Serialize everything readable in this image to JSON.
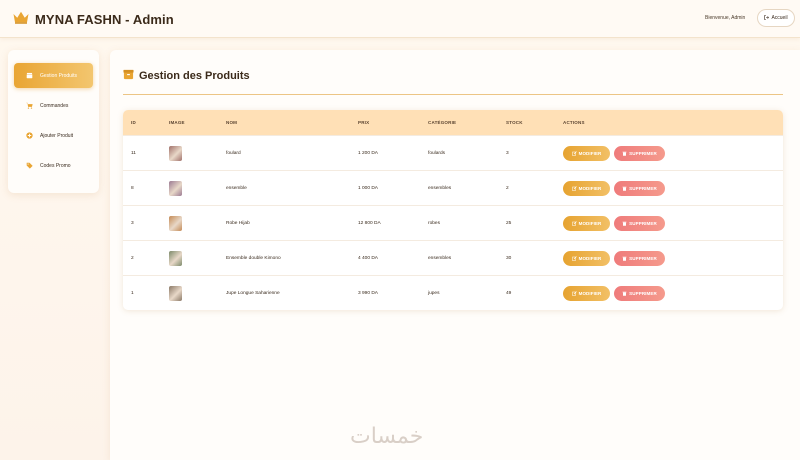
{
  "header": {
    "brand_title": "MYNA FASHN - Admin",
    "welcome_text": "Bienvenue, Admin",
    "home_button_label": "Accueil"
  },
  "sidebar": {
    "items": [
      {
        "label": "Gestion Produits",
        "icon": "box-icon",
        "active": true
      },
      {
        "label": "Commandes",
        "icon": "cart-icon",
        "active": false
      },
      {
        "label": "Ajouter Produit",
        "icon": "plus-circle-icon",
        "active": false
      },
      {
        "label": "Codes Promo",
        "icon": "tag-icon",
        "active": false
      }
    ]
  },
  "main": {
    "title": "Gestion des Produits",
    "columns": [
      "ID",
      "IMAGE",
      "NOM",
      "PRIX",
      "CATÉGORIE",
      "STOCK",
      "ACTIONS"
    ],
    "rows": [
      {
        "id": "11",
        "name": "foulard",
        "price": "1 200 DA",
        "category": "foulards",
        "stock": "3",
        "thumb_color": "#a0706a"
      },
      {
        "id": "8",
        "name": "ensemble",
        "price": "1 000 DA",
        "category": "ensembles",
        "stock": "2",
        "thumb_color": "#9b7a92"
      },
      {
        "id": "3",
        "name": "Robe Hijab",
        "price": "12 800 DA",
        "category": "robes",
        "stock": "25",
        "thumb_color": "#c48a55"
      },
      {
        "id": "2",
        "name": "Ensemble double Kimono",
        "price": "4 400 DA",
        "category": "ensembles",
        "stock": "30",
        "thumb_color": "#7c8a6a"
      },
      {
        "id": "1",
        "name": "Jupe Longue Saharienne",
        "price": "3 990 DA",
        "category": "jupes",
        "stock": "49",
        "thumb_color": "#8a7866"
      }
    ],
    "edit_label": "MODIFIER",
    "delete_label": "SUPPRIMER"
  },
  "watermark": "خمسات",
  "colors": {
    "accent": "#e9a533",
    "delete": "#ef7b7b",
    "table_header": "#ffe0b6"
  }
}
